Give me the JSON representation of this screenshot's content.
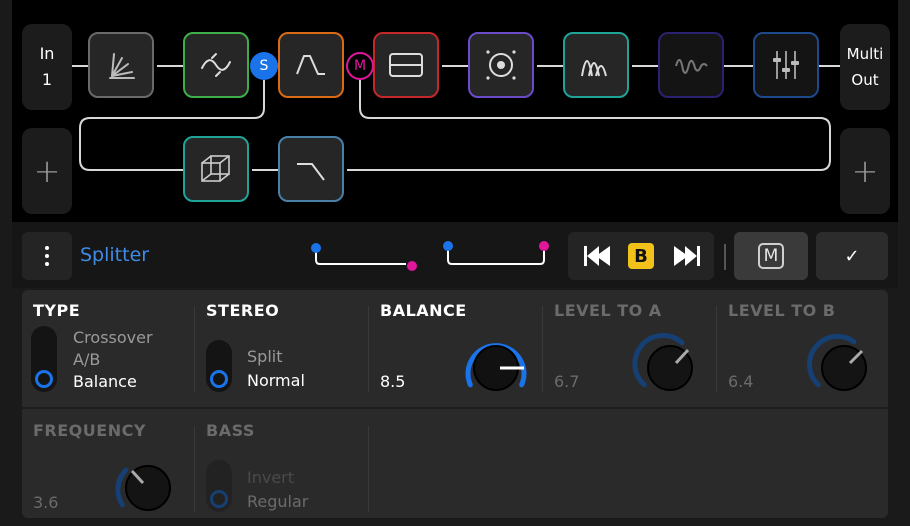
{
  "chain": {
    "input": {
      "label": "In",
      "number": "1"
    },
    "output": {
      "line1": "Multi",
      "line2": "Out"
    },
    "add_left": "+",
    "add_right": "+",
    "split_node": "S",
    "merge_node": "M"
  },
  "toolbar": {
    "block_name": "Splitter",
    "active_preset": "B",
    "m_label": "M",
    "confirm": "✓"
  },
  "params": {
    "type": {
      "title": "TYPE",
      "options": [
        "Crossover",
        "A/B",
        "Balance"
      ],
      "selected": "Balance"
    },
    "stereo": {
      "title": "STEREO",
      "options": [
        "Split",
        "Normal"
      ],
      "selected": "Normal"
    },
    "balance": {
      "title": "BALANCE",
      "value": "8.5"
    },
    "level_a": {
      "title": "LEVEL TO A",
      "value": "6.7"
    },
    "level_b": {
      "title": "LEVEL TO B",
      "value": "6.4"
    },
    "frequency": {
      "title": "FREQUENCY",
      "value": "3.6"
    },
    "bass": {
      "title": "BASS",
      "options": [
        "Invert",
        "Regular"
      ],
      "selected": "Regular"
    }
  },
  "colors": {
    "accent": "#1a73e8",
    "merge": "#e0169b",
    "badge": "#f2c21b"
  }
}
